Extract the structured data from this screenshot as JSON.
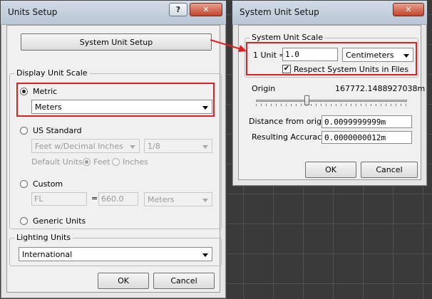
{
  "units_setup": {
    "title": "Units Setup",
    "help_glyph": "?",
    "close_glyph": "✕",
    "system_unit_setup_button": "System Unit Setup",
    "display_unit_scale": {
      "legend": "Display Unit Scale",
      "metric_label": "Metric",
      "metric_value": "Meters",
      "us_standard_label": "US Standard",
      "us_value": "Feet w/Decimal Inches",
      "us_fraction": "1/8",
      "default_units_label": "Default Units:",
      "feet_label": "Feet",
      "inches_label": "Inches",
      "custom_label": "Custom",
      "custom_name": "FL",
      "equals": "=",
      "custom_value": "660.0",
      "custom_unit": "Meters",
      "generic_label": "Generic Units"
    },
    "lighting_units": {
      "legend": "Lighting Units",
      "value": "International"
    },
    "ok_label": "OK",
    "cancel_label": "Cancel"
  },
  "system_unit_setup": {
    "title": "System Unit Setup",
    "close_glyph": "✕",
    "system_unit_scale": {
      "legend": "System Unit Scale",
      "unit_label": "1 Unit =",
      "unit_value": "1.0",
      "unit_type": "Centimeters",
      "respect_label": "Respect System Units in Files",
      "respect_checked": true
    },
    "origin_label": "Origin",
    "origin_value": "167772.1488927038m",
    "distance_label": "Distance from origin:",
    "distance_value": "0.0099999999m",
    "accuracy_label": "Resulting Accuracy:",
    "accuracy_value": "0.0000000012m",
    "ok_label": "OK",
    "cancel_label": "Cancel"
  },
  "colors": {
    "highlight": "#e02020",
    "viewport_bg": "#3a3a3a",
    "dialog_bg": "#f0f0f0"
  }
}
